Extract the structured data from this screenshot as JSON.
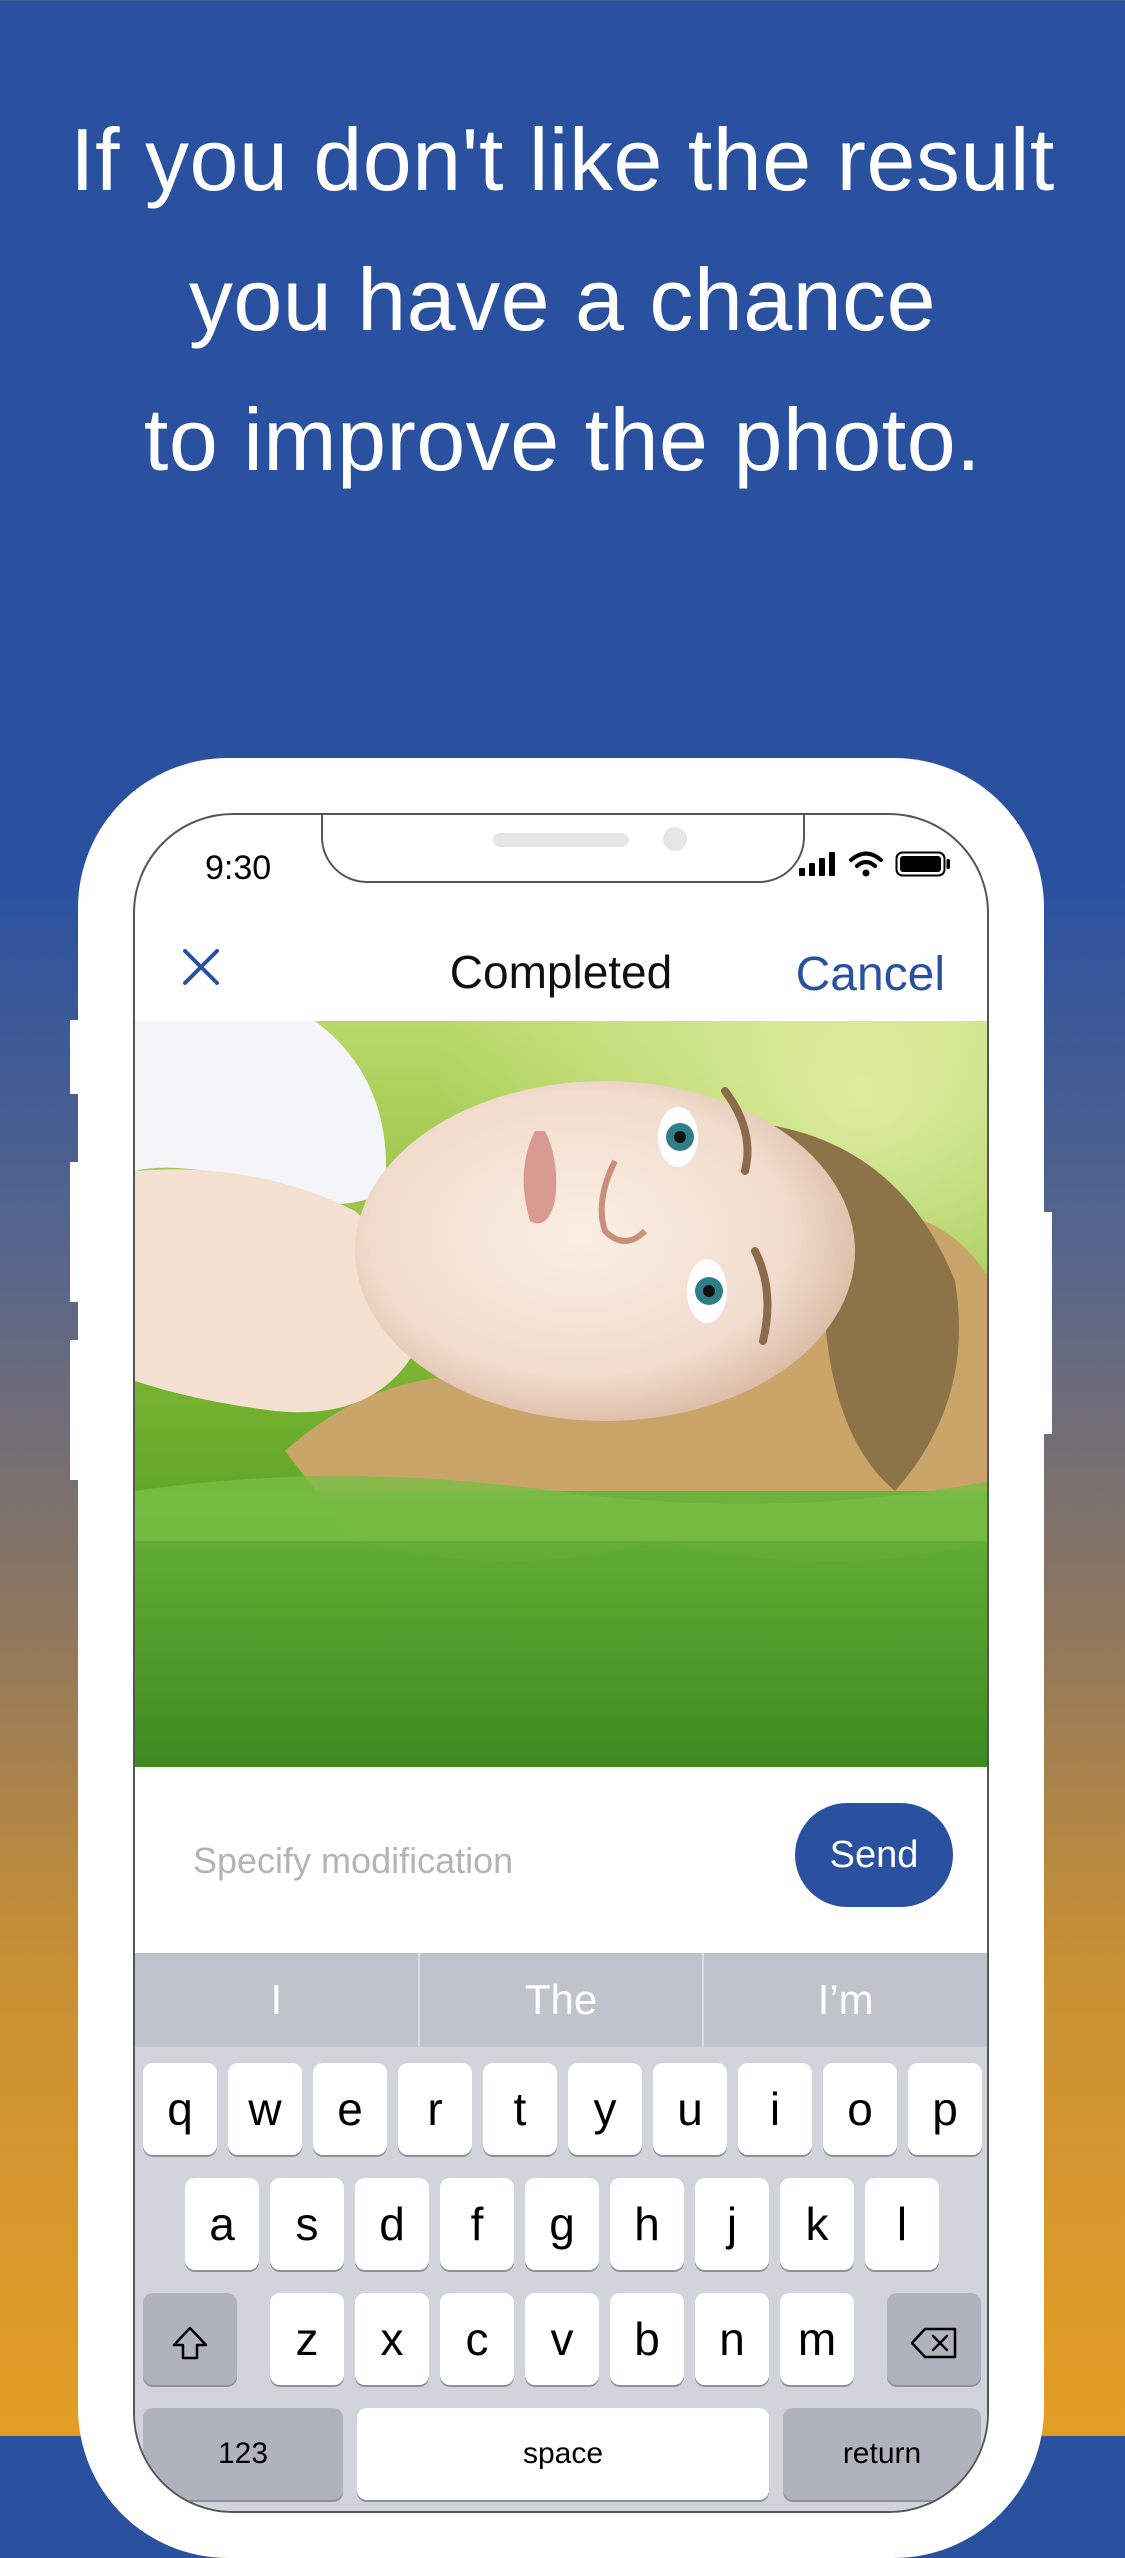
{
  "headline": {
    "line1": "If you don't like the result",
    "line2": "you have a chance",
    "line3": "to improve the photo."
  },
  "status_bar": {
    "time": "9:30",
    "icons": [
      "signal-icon",
      "wifi-icon",
      "battery-icon"
    ]
  },
  "nav": {
    "close_icon": "close-icon",
    "title": "Completed",
    "cancel_label": "Cancel"
  },
  "photo": {
    "subject": "woman lying on grass"
  },
  "modification": {
    "placeholder": "Specify modification",
    "value": "",
    "send_label": "Send"
  },
  "keyboard": {
    "suggestions": [
      "I",
      "The",
      "I’m"
    ],
    "row1": [
      "q",
      "w",
      "e",
      "r",
      "t",
      "y",
      "u",
      "i",
      "o",
      "p"
    ],
    "row2": [
      "a",
      "s",
      "d",
      "f",
      "g",
      "h",
      "j",
      "k",
      "l"
    ],
    "row3": [
      "z",
      "x",
      "c",
      "v",
      "b",
      "n",
      "m"
    ],
    "bottom": {
      "numbers": "123",
      "space": "space",
      "return": "return"
    },
    "shift_icon": "shift-icon",
    "delete_icon": "delete-icon"
  },
  "colors": {
    "brand": "#2a51a0",
    "gradient_bottom": "#e39e25"
  }
}
